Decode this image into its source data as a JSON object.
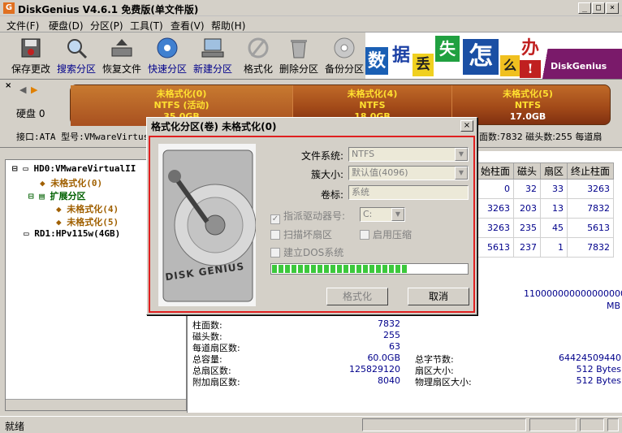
{
  "app": {
    "title": "DiskGenius V4.6.1 免费版(单文件版)",
    "icon": "diskgenius-icon"
  },
  "window_buttons": [
    "_",
    "□",
    "×"
  ],
  "menu": [
    "文件(F)",
    "硬盘(D)",
    "分区(P)",
    "工具(T)",
    "查看(V)",
    "帮助(H)"
  ],
  "toolbar": [
    {
      "label": "保存更改",
      "icon": "save-icon"
    },
    {
      "label": "搜索分区",
      "icon": "search-icon"
    },
    {
      "label": "恢复文件",
      "icon": "restore-icon"
    },
    {
      "label": "快速分区",
      "icon": "quick-partition-icon"
    },
    {
      "label": "新建分区",
      "icon": "new-partition-icon"
    },
    {
      "label": "格式化",
      "icon": "format-icon"
    },
    {
      "label": "删除分区",
      "icon": "delete-icon"
    },
    {
      "label": "备份分区",
      "icon": "backup-icon"
    }
  ],
  "banner": {
    "chars": [
      "数",
      "据",
      "丢",
      "失",
      "怎",
      "么",
      "办",
      "!"
    ],
    "brand": "DiskGenius"
  },
  "disk_strip": {
    "disk_label": "硬盘 0",
    "partitions": [
      {
        "name": "未格式化(0)",
        "fs": "NTFS (活动)",
        "size": "35.0GB"
      },
      {
        "name": "未格式化(4)",
        "fs": "NTFS",
        "size": "18.0GB"
      },
      {
        "name": "未格式化(5)",
        "fs": "NTFS",
        "size": "17.0GB"
      }
    ],
    "info_left": "接口:ATA  型号:VMwareVirtus",
    "info_right": "面数:7832  磁头数:255  每道扇"
  },
  "tree": {
    "items": [
      {
        "label": "HD0:VMwareVirtualII",
        "color": "#000000"
      },
      {
        "label": "未格式化(0)",
        "color": "#a06000"
      },
      {
        "label": "扩展分区",
        "color": "#006000"
      },
      {
        "label": "未格式化(4)",
        "color": "#a06000"
      },
      {
        "label": "未格式化(5)",
        "color": "#a06000"
      },
      {
        "label": "RD1:HPv115w(4GB)",
        "color": "#000000"
      }
    ]
  },
  "grid": {
    "headers": [
      "始柱面",
      "磁头",
      "扇区",
      "终止柱面"
    ],
    "rows": [
      [
        "0",
        "32",
        "33",
        "3263"
      ],
      [
        "3263",
        "203",
        "13",
        "7832"
      ],
      [
        "3263",
        "235",
        "45",
        "5613"
      ],
      [
        "5613",
        "237",
        "1",
        "7832"
      ]
    ]
  },
  "id_line": {
    "value": "1100000000000000000",
    "suffix": "MB"
  },
  "details": {
    "left": [
      {
        "k": "柱面数:",
        "v": "7832"
      },
      {
        "k": "磁头数:",
        "v": "255"
      },
      {
        "k": "每道扇区数:",
        "v": "63"
      },
      {
        "k": "总容量:",
        "v": "60.0GB"
      },
      {
        "k": "总扇区数:",
        "v": "125829120"
      },
      {
        "k": "附加扇区数:",
        "v": "8040"
      }
    ],
    "right": [
      {
        "k": "总字节数:",
        "v": "64424509440"
      },
      {
        "k": "扇区大小:",
        "v": "512 Bytes"
      },
      {
        "k": "物理扇区大小:",
        "v": "512 Bytes"
      }
    ]
  },
  "status": {
    "text": "就绪"
  },
  "dialog": {
    "title": "格式化分区(卷) 未格式化(0)",
    "close": "×",
    "image_text": "DISK GENIUS",
    "fields": [
      {
        "label": "文件系统:",
        "value": "NTFS"
      },
      {
        "label": "簇大小:",
        "value": "默认值(4096)"
      },
      {
        "label": "卷标:",
        "value": "系统"
      }
    ],
    "drive_letter": {
      "label": "指派驱动器号:",
      "value": "C:",
      "checked": "✓"
    },
    "scan_bad": "扫描坏扇区",
    "compress": "启用压缩",
    "dos": "建立DOS系统",
    "progress": 0.7,
    "format_button": "格式化",
    "cancel_button": "取消"
  }
}
